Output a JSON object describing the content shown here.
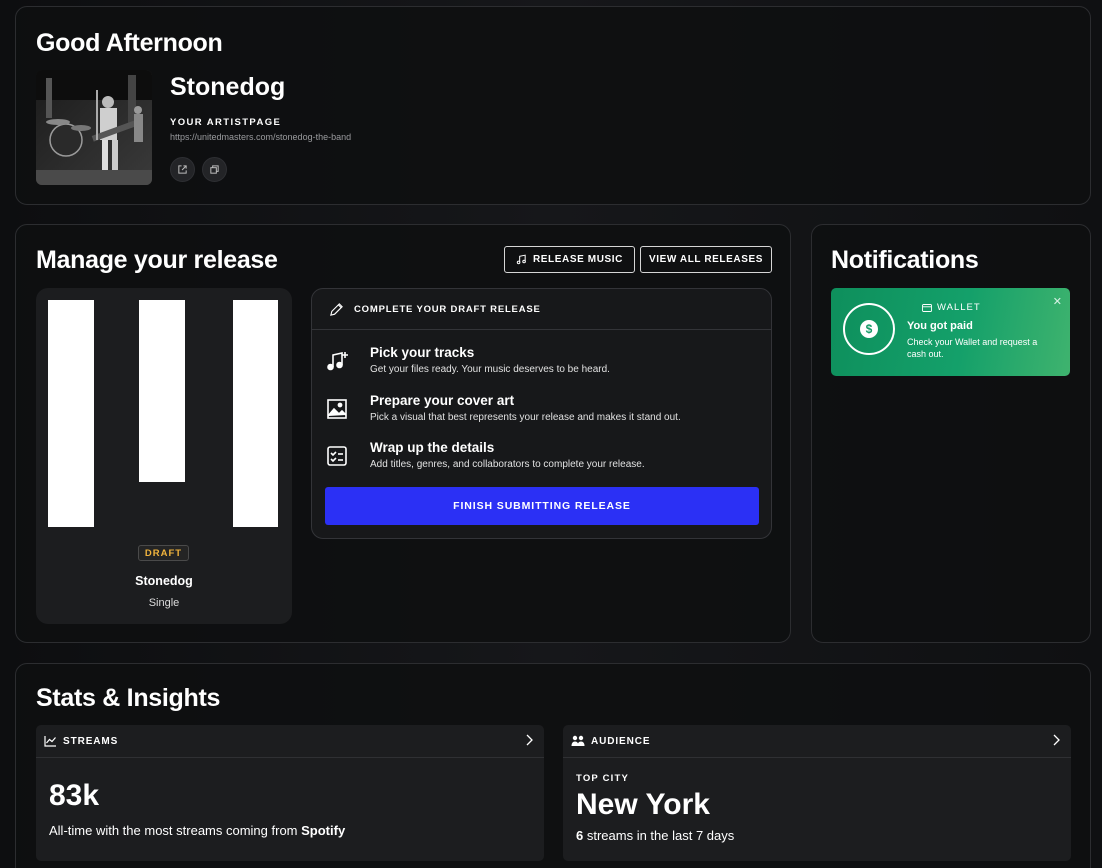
{
  "greeting": "Good Afternoon",
  "artist": {
    "name": "Stonedog",
    "page_label": "YOUR ARTISTPAGE",
    "page_url": "https://unitedmasters.com/stonedog-the-band",
    "photo_icon": "band-photo",
    "open_icon": "external-link-icon",
    "copy_icon": "copy-icon"
  },
  "release": {
    "title": "Manage your release",
    "release_music_label": "RELEASE MUSIC",
    "view_all_label": "VIEW ALL RELEASES",
    "draft": {
      "badge": "DRAFT",
      "name": "Stonedog",
      "type": "Single"
    },
    "steps_header": "COMPLETE YOUR DRAFT RELEASE",
    "steps": [
      {
        "title": "Pick your tracks",
        "desc": "Get your files ready. Your music deserves to be heard.",
        "icon": "music-add-icon"
      },
      {
        "title": "Prepare your cover art",
        "desc": "Pick a visual that best represents your release and makes it stand out.",
        "icon": "image-icon"
      },
      {
        "title": "Wrap up the details",
        "desc": "Add titles, genres, and collaborators to complete your release.",
        "icon": "checklist-icon"
      }
    ],
    "finish_label": "FINISH SUBMITTING RELEASE"
  },
  "notifications": {
    "title": "Notifications",
    "items": [
      {
        "label": "WALLET",
        "title": "You got paid",
        "desc": "Check your Wallet and request a cash out.",
        "icon": "dollar-coin-icon"
      }
    ]
  },
  "stats": {
    "title": "Stats & Insights",
    "streams": {
      "label": "STREAMS",
      "value": "83k",
      "desc_prefix": "All-time with the most streams coming from ",
      "desc_source": "Spotify"
    },
    "audience": {
      "label": "AUDIENCE",
      "top_city_label": "TOP CITY",
      "top_city": "New York",
      "streams_count": "6",
      "streams_suffix": " streams in the last 7 days"
    }
  },
  "colors": {
    "accent": "#2b30f5",
    "draft": "#f1b43d",
    "wallet_green": "#14a06a"
  }
}
